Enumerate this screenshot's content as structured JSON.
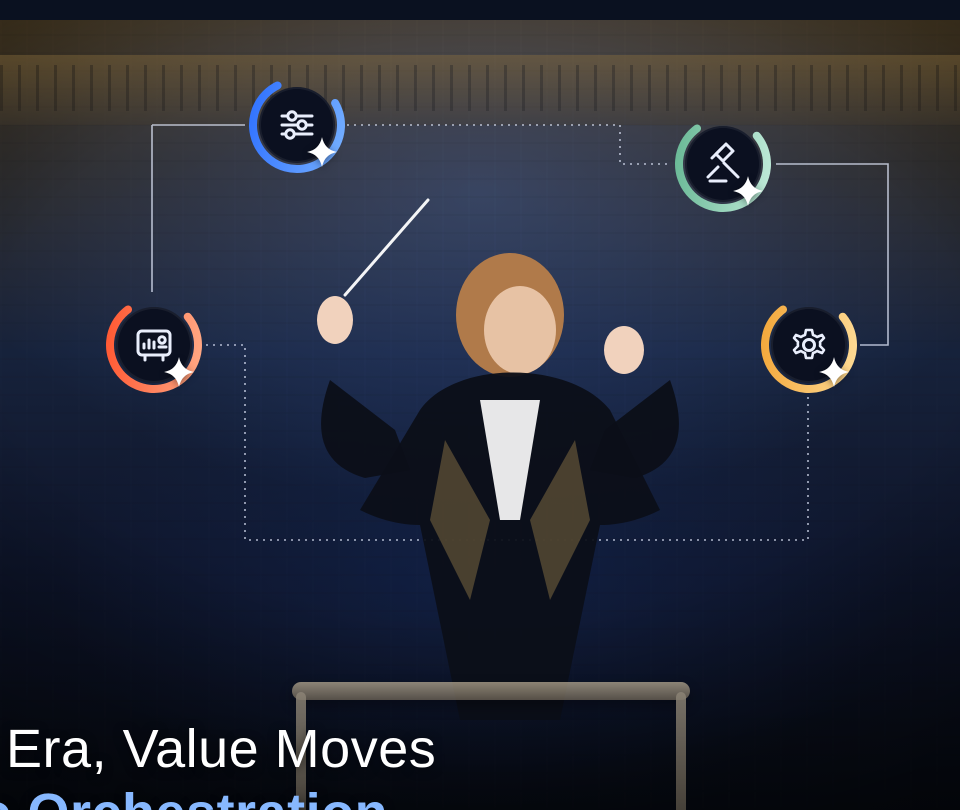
{
  "headline": {
    "line1": "a Era, Value Moves",
    "line2": "to Orchestration"
  },
  "icons": {
    "sliders": "sliders-icon",
    "gavel": "gavel-icon",
    "dashboard": "dashboard-icon",
    "gear": "gear-icon",
    "spark": "sparkle-icon"
  },
  "colors": {
    "blue": "#2f79ff",
    "green": "#67b596",
    "orange": "#ff6a2f",
    "yellow": "#f3b23b",
    "line": "#d9e3ff"
  }
}
